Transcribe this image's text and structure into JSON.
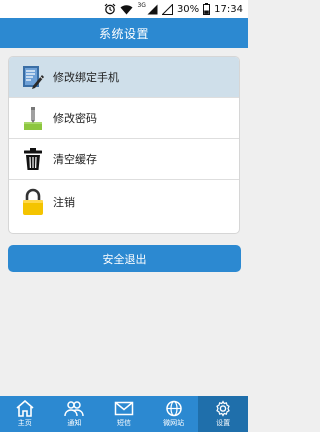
{
  "status_bar": {
    "network_type": "3G",
    "battery": "30%",
    "time": "17:34"
  },
  "header": {
    "title": "系统设置"
  },
  "settings": {
    "items": [
      {
        "label": "修改绑定手机",
        "icon": "phone-edit-icon",
        "selected": true
      },
      {
        "label": "修改密码",
        "icon": "password-pen-icon",
        "selected": false
      },
      {
        "label": "清空缓存",
        "icon": "trash-icon",
        "selected": false
      },
      {
        "label": "注销",
        "icon": "lock-icon",
        "selected": false
      }
    ]
  },
  "logout_button": {
    "label": "安全退出"
  },
  "tab_bar": {
    "items": [
      {
        "label": "主页",
        "icon": "home-icon",
        "active": false
      },
      {
        "label": "通知",
        "icon": "people-icon",
        "active": false
      },
      {
        "label": "短信",
        "icon": "envelope-icon",
        "active": false
      },
      {
        "label": "微网站",
        "icon": "globe-icon",
        "active": false
      },
      {
        "label": "设置",
        "icon": "gear-icon",
        "active": true
      }
    ]
  },
  "colors": {
    "primary": "#2c89d1",
    "active_tab": "#1f6fab",
    "selected_row": "#cfdfea",
    "lock": "#f4c400"
  }
}
